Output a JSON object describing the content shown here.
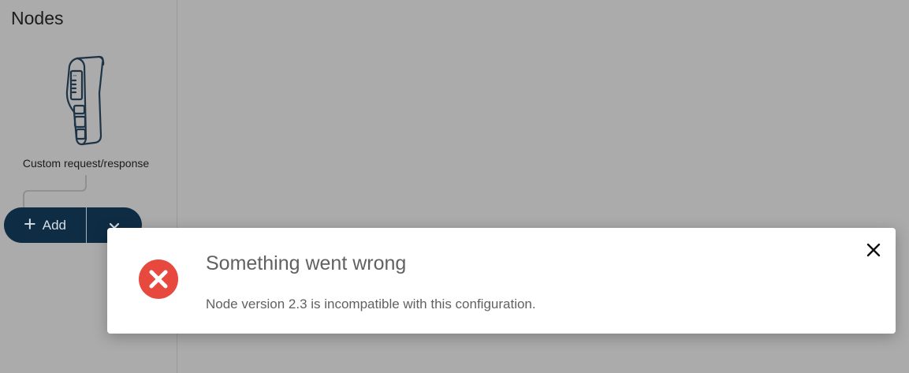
{
  "sidebar": {
    "title": "Nodes",
    "node": {
      "label": "Custom request/response",
      "icon": "gateway-device-icon"
    },
    "add_button": {
      "label": "Add",
      "icon": "plus-icon",
      "dropdown_icon": "chevron-down-icon"
    }
  },
  "toast": {
    "title": "Something went wrong",
    "message": "Node version 2.3 is incompatible with this configuration.",
    "icon": "error-icon",
    "close_icon": "close-icon",
    "error_color": "#e8493f"
  },
  "colors": {
    "overlay_background": "#ababab",
    "button_background": "#0e2d45",
    "toast_background": "#ffffff"
  }
}
